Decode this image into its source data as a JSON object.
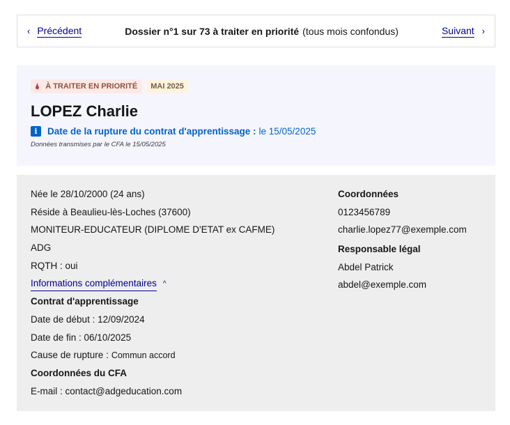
{
  "nav": {
    "prev_label": "Précédent",
    "next_label": "Suivant",
    "title": "Dossier n°1 sur 73 à traiter en priorité",
    "subtitle": "(tous mois confondus)"
  },
  "card": {
    "priority_badge": "À TRAITER EN PRIORITÉ",
    "month_badge": "MAI 2025",
    "name": "LOPEZ Charlie",
    "rupture_label": "Date de la rupture du contrat d'apprentissage :",
    "rupture_value": "le 15/05/2025",
    "transmis": "Données transmises par le CFA le 15/05/2025"
  },
  "details": {
    "left": {
      "birth": "Née le 28/10/2000 (24 ans)",
      "residence": "Réside à Beaulieu-lès-Loches (37600)",
      "diploma": "MONITEUR-EDUCATEUR (DIPLOME D'ETAT ex CAFME)",
      "org": "ADG",
      "rqth": "RQTH : oui",
      "more_info_link": "Informations complémentaires",
      "contract_heading": "Contrat d'apprentissage",
      "start_date": "Date de début : 12/09/2024",
      "end_date": "Date de fin : 06/10/2025",
      "cause_label": "Cause de rupture :",
      "cause_value": "Commun accord",
      "cfa_heading": "Coordonnées du CFA",
      "cfa_email": "E-mail : contact@adgeducation.com"
    },
    "right": {
      "contact_heading": "Coordonnées",
      "phone": "0123456789",
      "email": "charlie.lopez77@exemple.com",
      "legal_heading": "Responsable légal",
      "legal_name": "Abdel Patrick",
      "legal_email": "abdel@exemple.com"
    }
  },
  "colors": {
    "link_blue": "#000091",
    "info_blue": "#0063cb",
    "card_bg": "#f5f5fe",
    "details_bg": "#eeeeee",
    "priority_badge_bg": "#fee9e6"
  },
  "icons": {
    "prev": "chevron-left-icon",
    "next": "chevron-right-icon",
    "priority": "drop-icon",
    "info": "info-icon",
    "expand": "caret-up-icon"
  }
}
